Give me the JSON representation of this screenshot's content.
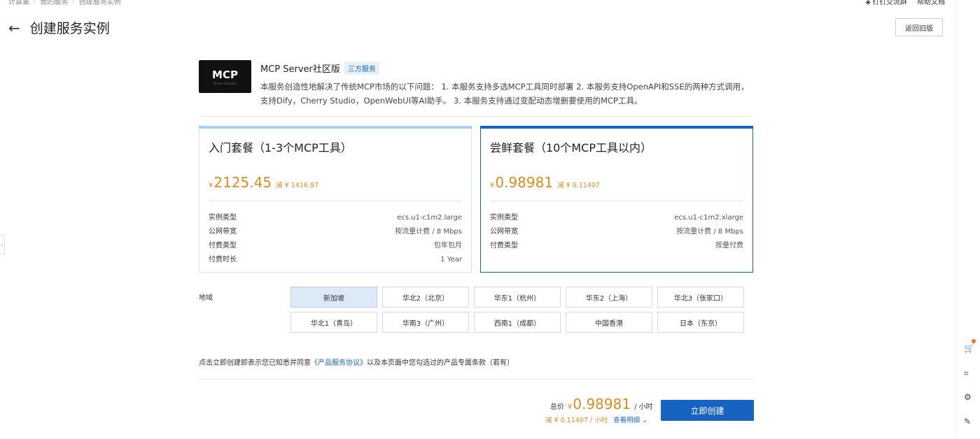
{
  "breadcrumb": [
    "计算巢",
    "我的服务",
    "创建服务实例"
  ],
  "top_links": {
    "dingtalk": "钉钉交流群",
    "help": "帮助文档"
  },
  "page": {
    "title": "创建服务实例",
    "return_label": "返回旧版"
  },
  "service": {
    "logo_text": "MCP",
    "logo_sub": "Market Template",
    "name": "MCP Server社区版",
    "badge": "三方服务",
    "description": "本服务创造性地解决了传统MCP市场的以下问题： 1. 本服务支持多选MCP工具同时部署 2. 本服务支持OpenAPI和SSE的两种方式调用，支持Dify，Cherry Studio，OpenWebUI等AI助手。 3. 本服务支持通过变配动态增删要使用的MCP工具。"
  },
  "plans": [
    {
      "title": "入门套餐（1-3个MCP工具）",
      "currency": "¥",
      "price": "2125.45",
      "discount": "减 ¥ 1416.97",
      "selected": false,
      "specs": [
        {
          "k": "实例类型",
          "v": "ecs.u1-c1m2.large"
        },
        {
          "k": "公网带宽",
          "v": "按流量计费 / 8 Mbps"
        },
        {
          "k": "付费类型",
          "v": "包年包月"
        },
        {
          "k": "付费时长",
          "v": "1 Year"
        }
      ]
    },
    {
      "title": "尝鲜套餐（10个MCP工具以内）",
      "currency": "¥",
      "price": "0.98981",
      "discount": "减 ¥ 0.11407",
      "selected": true,
      "specs": [
        {
          "k": "实例类型",
          "v": "ecs.u1-c1m2.xlarge"
        },
        {
          "k": "公网带宽",
          "v": "按流量计费 / 8 Mbps"
        },
        {
          "k": "付费类型",
          "v": "按量付费"
        }
      ]
    }
  ],
  "region": {
    "label": "地域",
    "options": [
      "新加坡",
      "华北2（北京）",
      "华东1（杭州）",
      "华东2（上海）",
      "华北3（张家口）",
      "华北1（青岛）",
      "华南3（广州）",
      "西南1（成都）",
      "中国香港",
      "日本（东京）"
    ],
    "selected": "新加坡"
  },
  "agreement": {
    "prefix": "点击立即创建即表示您已知悉并同意",
    "link": "《产品服务协议》",
    "suffix": "以及本页面中您勾选过的产品专属条款（若有）"
  },
  "footer": {
    "total_label": "总价",
    "currency": "¥",
    "amount": "0.98981",
    "unit": "/ 小时",
    "discount": "减 ¥ 0.11407 / 小时",
    "detail": "查看明细",
    "create": "立即创建"
  },
  "colors": {
    "accent": "#1764c0",
    "price": "#e08a1f"
  }
}
